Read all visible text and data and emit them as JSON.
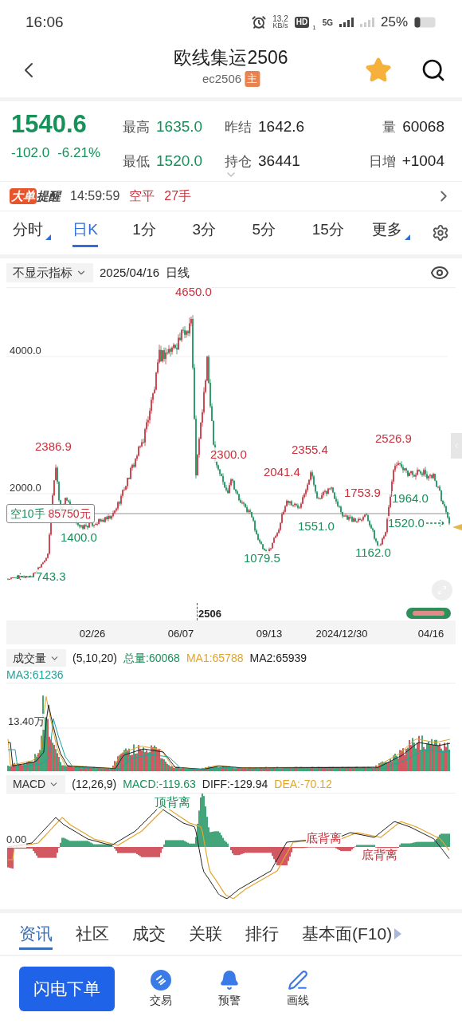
{
  "status_bar": {
    "time": "16:06",
    "net_speed": "13.2",
    "net_unit": "KB/s",
    "hd": "HD",
    "sim": "1",
    "network": "5G",
    "battery": "25%"
  },
  "header": {
    "title": "欧线集运2506",
    "code": "ec2506",
    "badge": "主",
    "favorite": true
  },
  "quote": {
    "price": "1540.6",
    "change": "-102.0",
    "change_pct": "-6.21%",
    "stats": [
      {
        "label": "最高",
        "value": "1635.0",
        "color": "#17905a"
      },
      {
        "label": "昨结",
        "value": "1642.6",
        "color": "#222222"
      },
      {
        "label": "量",
        "value": "60068",
        "color": "#222222"
      },
      {
        "label": "最低",
        "value": "1520.0",
        "color": "#17905a"
      },
      {
        "label": "持仓",
        "value": "36441",
        "color": "#222222"
      },
      {
        "label": "日增",
        "value": "+1004",
        "color": "#222222"
      }
    ]
  },
  "alert": {
    "tag_1": "大单",
    "tag_2": "提醒",
    "time": "14:59:59",
    "action": "空平",
    "amount": "27手"
  },
  "periods": [
    {
      "label": "分时",
      "selected": false,
      "menu": true
    },
    {
      "label": "日K",
      "selected": true,
      "menu": false
    },
    {
      "label": "1分",
      "selected": false,
      "menu": false
    },
    {
      "label": "3分",
      "selected": false,
      "menu": false
    },
    {
      "label": "5分",
      "selected": false,
      "menu": false
    },
    {
      "label": "15分",
      "selected": false,
      "menu": false
    },
    {
      "label": "更多",
      "selected": false,
      "menu": true
    }
  ],
  "indicator_row": {
    "indicator": "不显示指标",
    "date": "2025/04/16",
    "period": "日线"
  },
  "price_chart": {
    "y_labels": [
      "4000.0",
      "2000.0"
    ],
    "markers": [
      {
        "text": "4650.0",
        "color": "#c8313c",
        "kind": "label"
      },
      {
        "text": "2386.9",
        "color": "#c8313c",
        "kind": "label"
      },
      {
        "text": "2300.0",
        "color": "#c8313c",
        "kind": "label"
      },
      {
        "text": "2355.4",
        "color": "#c8313c",
        "kind": "label"
      },
      {
        "text": "2041.4",
        "color": "#c8313c",
        "kind": "label"
      },
      {
        "text": "2526.9",
        "color": "#c8313c",
        "kind": "label"
      },
      {
        "text": "1753.9",
        "color": "#c8313c",
        "kind": "label"
      },
      {
        "text": "1964.0",
        "color": "#17905a",
        "kind": "label"
      },
      {
        "text": "1400.0",
        "color": "#17905a",
        "kind": "label"
      },
      {
        "text": "1551.0",
        "color": "#17905a",
        "kind": "label"
      },
      {
        "text": "1079.5",
        "color": "#17905a",
        "kind": "label"
      },
      {
        "text": "1162.0",
        "color": "#17905a",
        "kind": "label"
      },
      {
        "text": "743.3",
        "color": "#17905a",
        "kind": "arrow_left"
      },
      {
        "text": "1520.0",
        "color": "#17905a",
        "kind": "arrow_right"
      }
    ],
    "position": {
      "side": "空10手",
      "value": "85750元"
    },
    "contract_mark": "2506",
    "dates": [
      "02/26",
      "06/07",
      "09/13",
      "2024/12/30",
      "04/16"
    ]
  },
  "volume": {
    "name": "成交量",
    "params": "(5,10,20)",
    "y_label": "13.40万",
    "stats": [
      {
        "text": "总量:60068",
        "color": "#1a8f5a"
      },
      {
        "text": "MA1:65788",
        "color": "#e0a52c"
      },
      {
        "text": "MA2:65939",
        "color": "#222222"
      },
      {
        "text": "MA3:61236",
        "color": "#23a29c"
      }
    ]
  },
  "macd": {
    "name": "MACD",
    "params": "(12,26,9)",
    "zero_label": "0.00",
    "stats": [
      {
        "text": "MACD:-119.63",
        "color": "#1a8f5a"
      },
      {
        "text": "DIFF:-129.94",
        "color": "#222222"
      },
      {
        "text": "DEA:-70.12",
        "color": "#e0a52c"
      }
    ],
    "signals": [
      {
        "text": "顶背离",
        "color": "#17905a"
      },
      {
        "text": "底背离",
        "color": "#c8313c"
      },
      {
        "text": "底背离",
        "color": "#c8313c"
      }
    ]
  },
  "info_tabs": [
    {
      "label": "资讯",
      "selected": true
    },
    {
      "label": "社区",
      "selected": false
    },
    {
      "label": "成交",
      "selected": false
    },
    {
      "label": "关联",
      "selected": false
    },
    {
      "label": "排行",
      "selected": false
    },
    {
      "label": "基本面(F10)",
      "selected": false
    }
  ],
  "bottom_bar": {
    "order_button": "闪电下单",
    "actions": [
      {
        "label": "交易",
        "kind": "trade"
      },
      {
        "label": "预警",
        "kind": "alert"
      },
      {
        "label": "画线",
        "kind": "draw"
      }
    ]
  }
}
